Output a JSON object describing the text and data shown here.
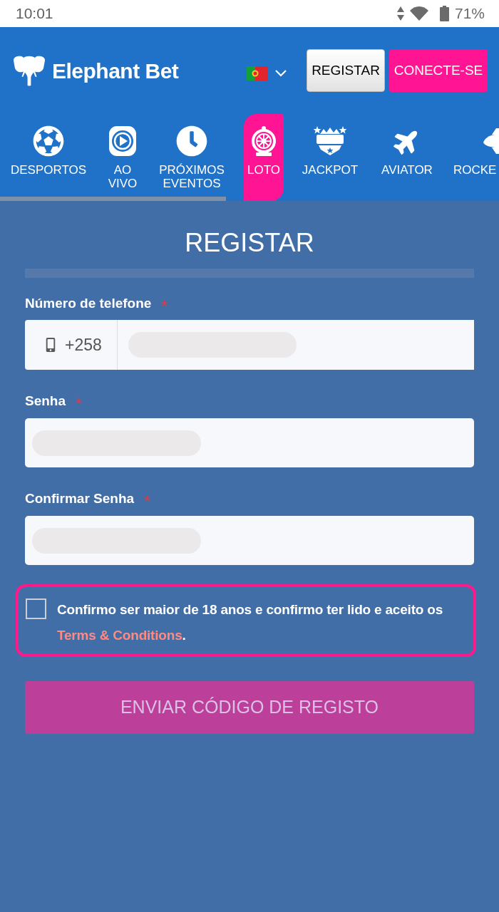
{
  "status_bar": {
    "time": "10:01",
    "battery": "71%"
  },
  "header": {
    "brand": "Elephant Bet",
    "buttons": [
      {
        "label": "REGISTAR",
        "kind": "outline"
      },
      {
        "label": "CONECTE-SE",
        "kind": "primary"
      }
    ]
  },
  "nav": {
    "items": [
      {
        "label": "DESPORTOS",
        "selected": false
      },
      {
        "label": "AO VIVO",
        "selected": false
      },
      {
        "label": "PRÓXIMOS EVENTOS",
        "selected": false
      },
      {
        "label": "LOTO",
        "selected": true
      },
      {
        "label": "JACKPOT",
        "selected": false
      },
      {
        "label": "AVIATOR",
        "selected": false
      },
      {
        "label": "ROCKE",
        "selected": false
      }
    ]
  },
  "form": {
    "title": "REGISTAR",
    "fields": [
      {
        "kind": "phone",
        "label": "Número de telefone",
        "required": true,
        "prefix": "+258"
      },
      {
        "kind": "password",
        "label": "Senha",
        "required": true
      },
      {
        "kind": "password",
        "label": "Confirmar Senha",
        "required": true
      }
    ],
    "consent": {
      "text": "Confirmo ser maior de 18 anos e confirmo ter lido e aceito os",
      "link": "Terms & Conditions",
      "suffix": ".",
      "checked": false
    },
    "submit": {
      "label": "ENVIAR CÓDIGO DE REGISTO",
      "disabled": true
    }
  }
}
